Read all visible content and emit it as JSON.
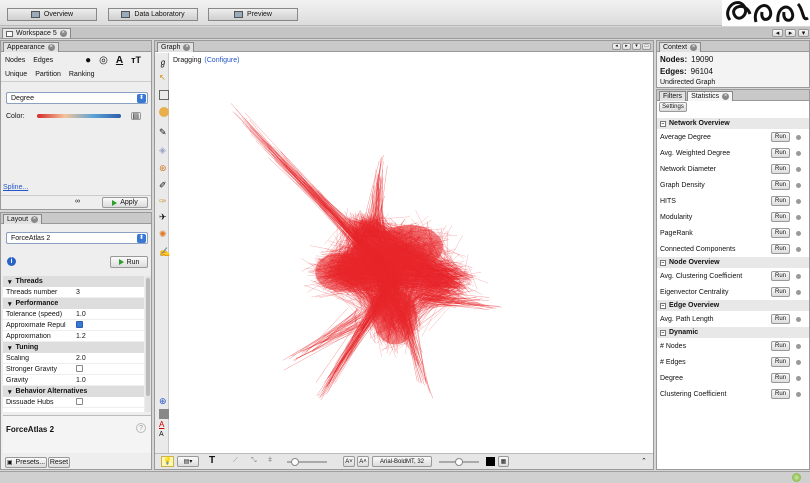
{
  "topbar": {
    "overview_label": "Overview",
    "data_lab_label": "Data Laboratory",
    "preview_label": "Preview"
  },
  "workspace": {
    "tab_label": "Workspace 5"
  },
  "appearance": {
    "title": "Appearance",
    "tabs": [
      "Nodes",
      "Edges"
    ],
    "subtabs": [
      "Unique",
      "Partition",
      "Ranking"
    ],
    "selected_ranking": "Degree",
    "color_label": "Color:",
    "spline_label": "Spline...",
    "apply_label": "Apply"
  },
  "layout": {
    "title": "Layout",
    "algorithm": "ForceAtlas 2",
    "run_label": "Run",
    "sections": [
      {
        "header": "Threads",
        "props": [
          {
            "k": "Threads number",
            "v": "3"
          }
        ]
      },
      {
        "header": "Performance",
        "props": [
          {
            "k": "Tolerance (speed)",
            "v": "1.0"
          },
          {
            "k": "Approximate Repul",
            "check": true
          },
          {
            "k": "Approximation",
            "v": "1.2"
          }
        ]
      },
      {
        "header": "Tuning",
        "props": [
          {
            "k": "Scaling",
            "v": "2.0"
          },
          {
            "k": "Stronger Gravity",
            "check": false
          },
          {
            "k": "Gravity",
            "v": "1.0"
          }
        ]
      },
      {
        "header": "Behavior Alternatives",
        "props": [
          {
            "k": "Dissuade Hubs",
            "check": false
          }
        ]
      }
    ],
    "description_title": "ForceAtlas 2",
    "presets_label": "Presets...",
    "reset_label": "Reset"
  },
  "graph": {
    "title": "Graph",
    "dragging_label": "Dragging",
    "configure_label": "(Configure)",
    "font_label": "Arial-BoldMT, 32"
  },
  "context": {
    "title": "Context",
    "nodes_label": "Nodes:",
    "nodes_value": "19090",
    "edges_label": "Edges:",
    "edges_value": "96104",
    "graph_type": "Undirected Graph"
  },
  "statistics": {
    "filters_tab": "Filters",
    "stats_tab": "Statistics",
    "settings_label": "Settings",
    "run_label": "Run",
    "groups": [
      {
        "header": "Network Overview",
        "items": [
          "Average Degree",
          "Avg. Weighted Degree",
          "Network Diameter",
          "Graph Density",
          "HITS",
          "Modularity",
          "PageRank",
          "Connected Components"
        ]
      },
      {
        "header": "Node Overview",
        "items": [
          "Avg. Clustering Coefficient",
          "Eigenvector Centrality"
        ]
      },
      {
        "header": "Edge Overview",
        "items": [
          "Avg. Path Length"
        ]
      },
      {
        "header": "Dynamic",
        "items": [
          "# Nodes",
          "# Edges",
          "Degree",
          "Clustering Coefficient"
        ]
      }
    ]
  },
  "colors": {
    "graph_red": "#e8262a",
    "accent_blue": "#3a78d6"
  }
}
